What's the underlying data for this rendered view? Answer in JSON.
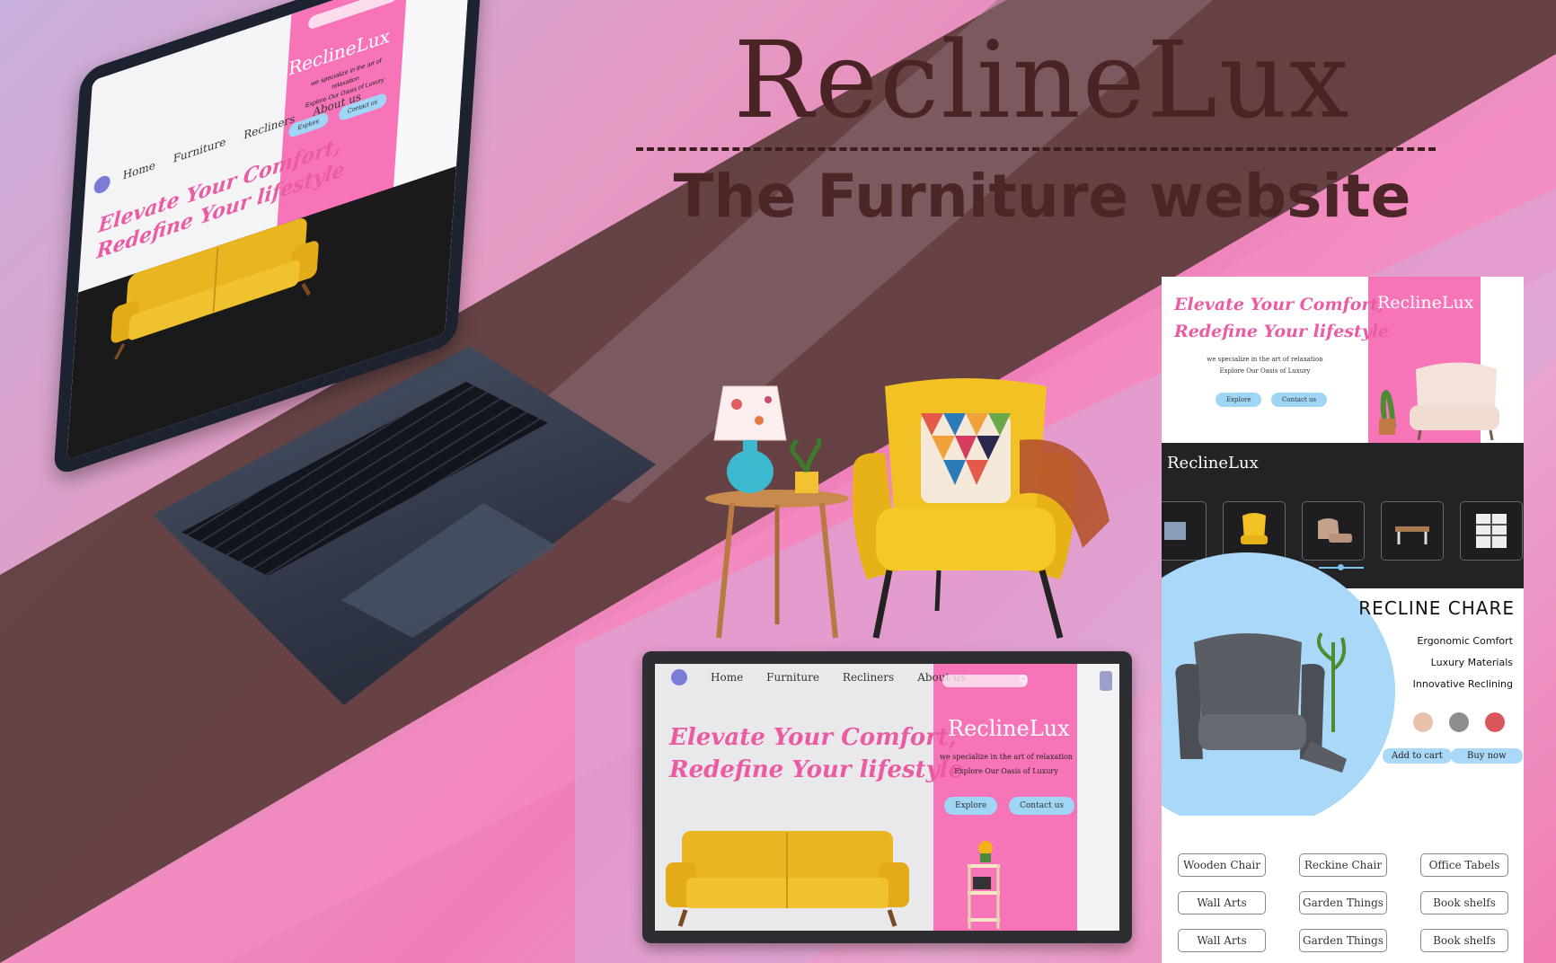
{
  "headline": {
    "title": "ReclineLux",
    "subtitle": "The Furniture website"
  },
  "laptop": {
    "nav": [
      "Home",
      "Furniture",
      "Recliners",
      "About us"
    ],
    "hero_line1": "Elevate Your Comfort,",
    "hero_line2": "Redefine Your lifestyle",
    "brand": "ReclineLux",
    "tagline1": "we specialize in the art of relaxation",
    "tagline2": "Explore Our Oasis of Luxury",
    "explore": "Explore",
    "contact": "Contact us"
  },
  "tablet": {
    "nav": [
      "Home",
      "Furniture",
      "Recliners",
      "About us"
    ],
    "hero_line1": "Elevate Your Comfort,",
    "hero_line2": "Redefine Your lifestyle",
    "brand": "ReclineLux",
    "tagline1": "we specialize in the art of relaxation",
    "tagline2": "Explore Our Oasis of Luxury",
    "explore": "Explore",
    "contact": "Contact us"
  },
  "longpage": {
    "hero_line1": "Elevate Your Comfort,",
    "hero_line2": "Redefine Your lifestyle",
    "brand_top": "ReclineLux",
    "tagline1": "we specialize in the art of relaxation",
    "tagline2": "Explore Our Oasis of Luxury",
    "explore": "Explore",
    "contact": "Contact us",
    "brand_dark": "ReclineLux",
    "product": {
      "title": "RECLINE CHARE",
      "features": [
        "Ergonomic Comfort",
        "Luxury Materials",
        "Innovative Reclining"
      ],
      "swatches": [
        "#e8c2ad",
        "#8e8e90",
        "#d9575b"
      ],
      "add_to_cart": "Add to cart",
      "buy_now": "Buy now"
    },
    "categories": [
      [
        "Wooden Chair",
        "Reckine Chair",
        "Office Tabels"
      ],
      [
        "Wall Arts",
        "Garden Things",
        "Book shelfs"
      ],
      [
        "Wall Arts",
        "Garden Things",
        "Book shelfs"
      ]
    ]
  },
  "colors": {
    "brand_pink": "#f774b9",
    "hero_text_pink": "#ea5ba3",
    "button_blue": "#9fd6f5",
    "title_brown": "#4a2424"
  }
}
